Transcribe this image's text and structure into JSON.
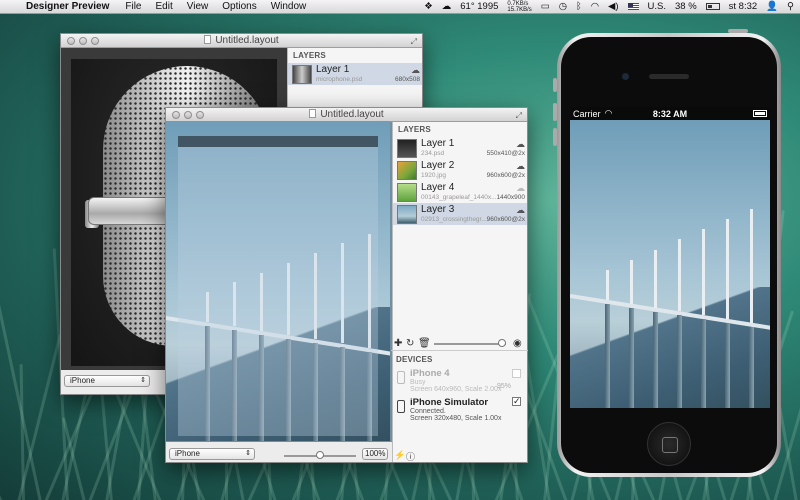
{
  "menubar": {
    "app_name": "Designer Preview",
    "menus": [
      "File",
      "Edit",
      "View",
      "Options",
      "Window"
    ],
    "temp": "61° 1995",
    "net_up": "0.7KB/s",
    "net_down": "15.7KB/s",
    "locale": "U.S.",
    "battery": "38 %",
    "clock": "st 8:32"
  },
  "back_window": {
    "title": "Untitled.layout",
    "layers_header": "LAYERS",
    "layer": {
      "name": "Layer 1",
      "file": "microphone.psd",
      "size": "680x508"
    },
    "device_select": "iPhone"
  },
  "front_window": {
    "title": "Untitled.layout",
    "layers_header": "LAYERS",
    "layers": [
      {
        "name": "Layer 1",
        "file": "234.psd",
        "size": "550x410@2x",
        "cloud": "cloud-icon"
      },
      {
        "name": "Layer 2",
        "file": "1920.jpg",
        "size": "960x600@2x",
        "cloud": "cloud-icon"
      },
      {
        "name": "Layer 4",
        "file": "00143_grapeleaf_1440x...",
        "size": "1440x900",
        "cloud": "cloud-icon"
      },
      {
        "name": "Layer 3",
        "file": "02913_crossingthegr...",
        "size": "960x600@2x",
        "cloud": "cloud-icon"
      }
    ],
    "devices_header": "DEVICES",
    "devices": [
      {
        "name": "iPhone 4",
        "status": "Busy",
        "detail": "Screen 640x960, Scale 2.00x",
        "battery": "95%"
      },
      {
        "name": "iPhone Simulator",
        "status": "Connected.",
        "detail": "Screen 320x480, Scale 1.00x"
      }
    ],
    "device_select": "iPhone",
    "zoom": "100%"
  },
  "iphone": {
    "carrier": "Carrier",
    "time": "8:32 AM"
  }
}
